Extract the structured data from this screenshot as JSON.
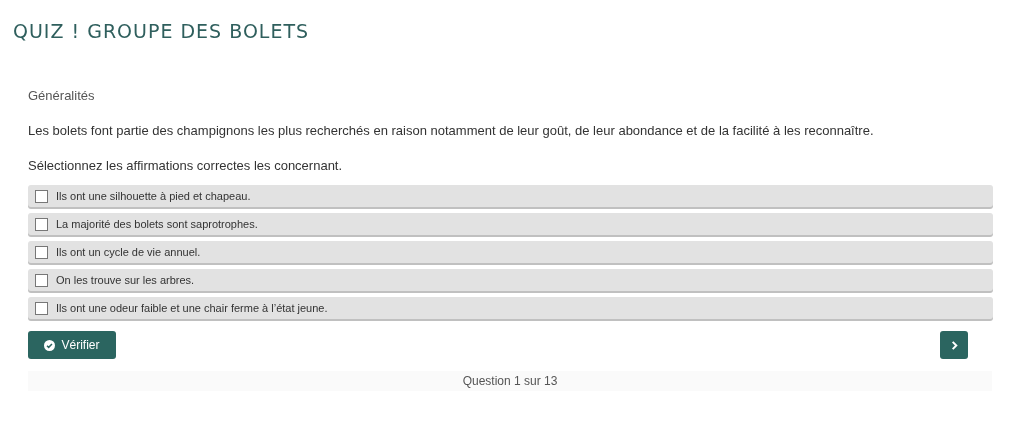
{
  "title": "QUIZ ! GROUPE DES BOLETS",
  "section": "Généralités",
  "intro": "Les bolets font partie des champignons les plus recherchés en raison notamment de leur goût, de leur abondance et de la facilité à les reconnaître.",
  "instruction": "Sélectionnez les affirmations correctes les concernant.",
  "options": [
    {
      "label": "Ils ont une silhouette à pied et chapeau.",
      "checked": false
    },
    {
      "label": "La majorité des bolets sont saprotrophes.",
      "checked": false
    },
    {
      "label": "Ils ont un cycle de vie annuel.",
      "checked": false
    },
    {
      "label": "On les trouve sur les arbres.",
      "checked": false
    },
    {
      "label": "Ils ont une odeur faible et une chair ferme à l’état jeune.",
      "checked": false
    }
  ],
  "check_button": "Vérifier",
  "progress": "Question 1 sur 13"
}
